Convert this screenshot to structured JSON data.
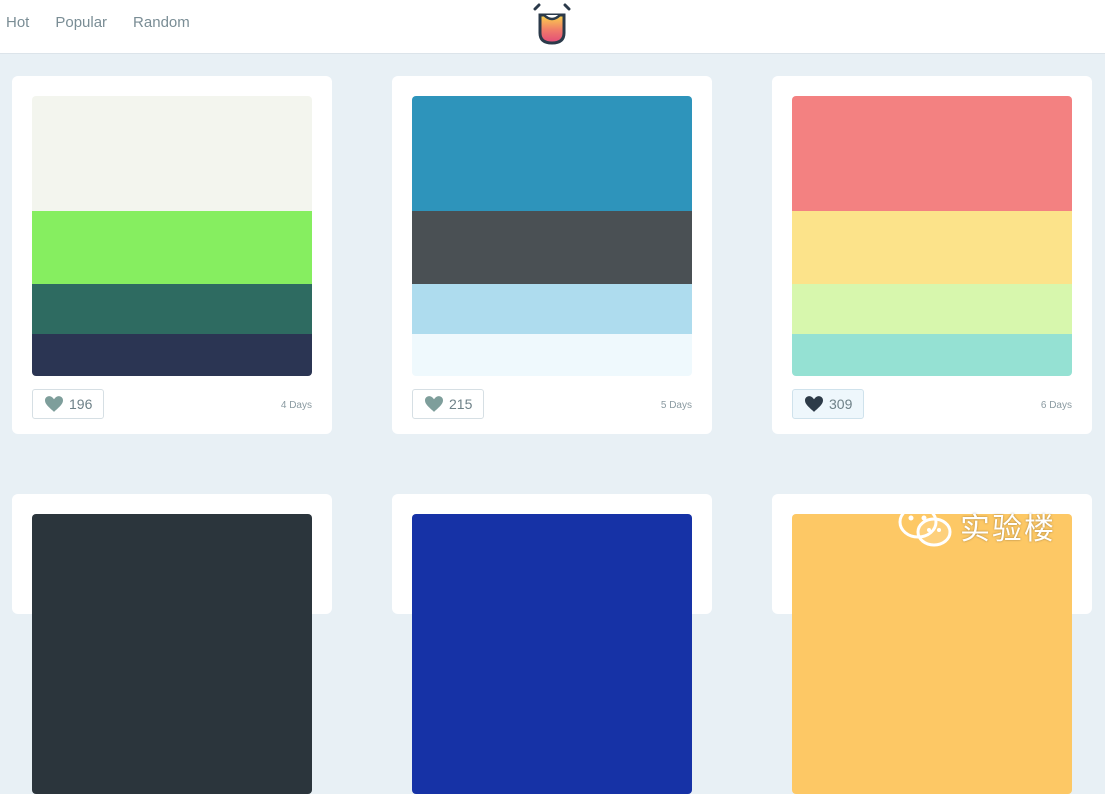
{
  "nav": {
    "items": [
      "Hot",
      "Popular",
      "Random"
    ]
  },
  "logo_icon": "smiley-cup-logo",
  "palettes": [
    {
      "likes": "196",
      "age": "4 Days",
      "liked": false,
      "colors": [
        "#f3f5ee",
        "#86ee60",
        "#2e6b61",
        "#2b3553"
      ]
    },
    {
      "likes": "215",
      "age": "5 Days",
      "liked": false,
      "colors": [
        "#2e94bb",
        "#4a5054",
        "#aedcee",
        "#eff9fd"
      ]
    },
    {
      "likes": "309",
      "age": "6 Days",
      "liked": true,
      "colors": [
        "#f38181",
        "#fce38a",
        "#d7f7ad",
        "#95e1d3"
      ]
    }
  ],
  "palettes_row2": [
    {
      "colors": [
        "#2b353c"
      ]
    },
    {
      "colors": [
        "#1632a6"
      ]
    },
    {
      "colors": [
        "#fdc865"
      ]
    }
  ],
  "watermark": {
    "text": "实验楼",
    "icon": "wechat-icon"
  },
  "colors": {
    "heart_default": "#7e9e9b",
    "heart_liked": "#2d3b48"
  }
}
